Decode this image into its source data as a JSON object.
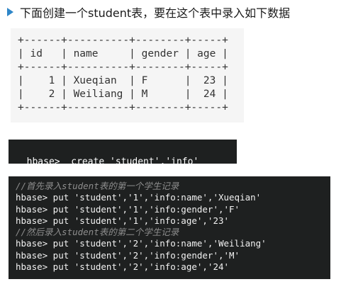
{
  "heading": {
    "text": "下面创建一个student表，要在这个表中录入如下数据",
    "bullet_color": "#2e86c8"
  },
  "table": {
    "columns": [
      "id",
      "name",
      "gender",
      "age"
    ],
    "rows": [
      [
        "1",
        "Xueqian",
        "F",
        "23"
      ],
      [
        "2",
        "Weiliang",
        "M",
        "24"
      ]
    ],
    "ascii": [
      "+------+----------+--------+-----+",
      "| id   | name     | gender | age |",
      "+------+----------+--------+-----+",
      "|    1 | Xueqian  | F      |  23 |",
      "|    2 | Weiliang | M      |  24 |",
      "+------+----------+--------+-----+"
    ]
  },
  "create_block": {
    "line": "hbase>  create 'student','info'"
  },
  "put_block": {
    "lines": [
      "//首先录入student表的第一个学生记录",
      "hbase> put 'student','1','info:name','Xueqian'",
      "hbase> put 'student','1','info:gender','F'",
      "hbase> put 'student','1','info:age','23'",
      "//然后录入student表的第二个学生记录",
      "hbase> put 'student','2','info:name','Weiliang'",
      "hbase> put 'student','2','info:gender','M'",
      "hbase> put 'student','2','info:age','24'"
    ]
  },
  "colors": {
    "terminal_bg": "#1e2020",
    "table_bg": "#f5f5f5",
    "comment": "#8d8d8d"
  }
}
